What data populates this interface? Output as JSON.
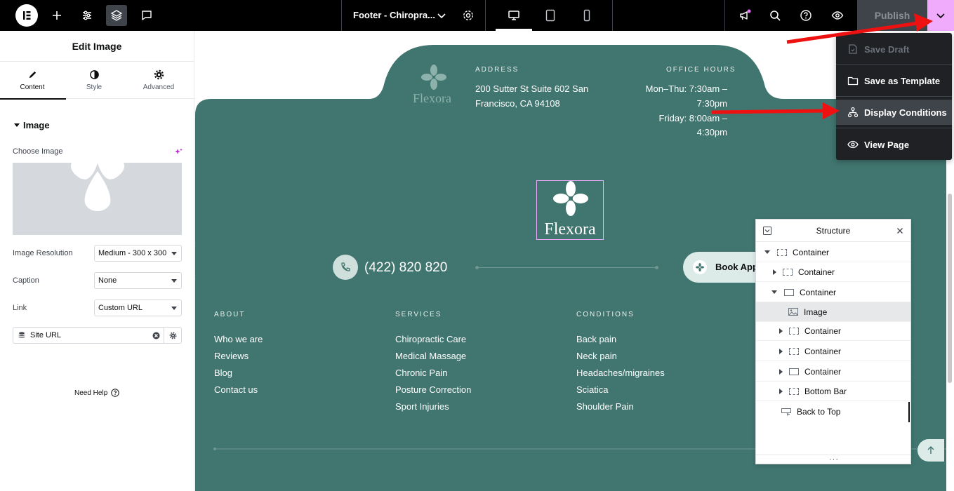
{
  "topbar": {
    "document_title": "Footer - Chiropra...",
    "publish_label": "Publish",
    "icons": [
      "elementor-logo-icon",
      "plus-icon",
      "settings-sliders-icon",
      "layers-icon",
      "comments-icon",
      "chevron-down-icon",
      "gear-icon",
      "desktop-icon",
      "tablet-icon",
      "mobile-icon",
      "megaphone-icon",
      "search-icon",
      "help-icon",
      "eye-icon",
      "chevron-down-icon"
    ]
  },
  "publish_menu": {
    "items": [
      {
        "label": "Save Draft",
        "icon": "save-draft-icon",
        "disabled": true
      },
      {
        "label": "Save as Template",
        "icon": "folder-icon",
        "disabled": false
      },
      {
        "label": "Display Conditions",
        "icon": "sitemap-icon",
        "disabled": false
      },
      {
        "label": "View Page",
        "icon": "eye-icon",
        "disabled": false
      }
    ]
  },
  "panel": {
    "title": "Edit Image",
    "tabs": [
      {
        "label": "Content",
        "icon": "pencil-icon",
        "active": true
      },
      {
        "label": "Style",
        "icon": "half-circle-icon",
        "active": false
      },
      {
        "label": "Advanced",
        "icon": "gear-icon",
        "active": false
      }
    ],
    "section_title": "Image",
    "choose_image_label": "Choose Image",
    "image_resolution_label": "Image Resolution",
    "image_resolution_value": "Medium - 300 x 300",
    "caption_label": "Caption",
    "caption_value": "None",
    "link_label": "Link",
    "link_value": "Custom URL",
    "url_value": "Site URL",
    "need_help": "Need Help"
  },
  "canvas": {
    "brand_name": "Flexora",
    "address_title": "ADDRESS",
    "address_line1": "200 Sutter St Suite 602 San",
    "address_line2": "Francisco, CA 94108",
    "hours_title": "OFFICE HOURS",
    "hours_line1": "Mon–Thu: 7:30am –",
    "hours_line2": "7:30pm",
    "hours_line3": "Friday: 8:00am –",
    "hours_line4": "4:30pm",
    "phone": "(422) 820 820",
    "book_button": "Book App",
    "columns": [
      {
        "title": "ABOUT",
        "links": [
          "Who we are",
          "Reviews",
          "Blog",
          "Contact us"
        ]
      },
      {
        "title": "SERVICES",
        "links": [
          "Chiropractic Care",
          "Medical Massage",
          "Chronic Pain",
          "Posture Correction",
          "Sport Injuries"
        ]
      },
      {
        "title": "CONDITIONS",
        "links": [
          "Back pain",
          "Neck pain",
          "Headaches/migraines",
          "Sciatica",
          "Shoulder Pain"
        ]
      }
    ],
    "colors": {
      "footer_green": "#41756f",
      "accent_pink": "#f0abfc"
    }
  },
  "structure": {
    "title": "Structure",
    "rows": [
      {
        "label": "Container",
        "depth": 0,
        "toggle": "open"
      },
      {
        "label": "Container",
        "depth": 1,
        "toggle": "closed"
      },
      {
        "label": "Container",
        "depth": 1,
        "toggle": "open"
      },
      {
        "label": "Image",
        "depth": 2,
        "toggle": "none",
        "selected": true
      },
      {
        "label": "Container",
        "depth": 2,
        "toggle": "closed"
      },
      {
        "label": "Container",
        "depth": 2,
        "toggle": "closed"
      },
      {
        "label": "Container",
        "depth": 2,
        "toggle": "closed"
      },
      {
        "label": "Bottom Bar",
        "depth": 2,
        "toggle": "closed"
      },
      {
        "label": "Back to Top",
        "depth": 1,
        "toggle": "none"
      }
    ]
  }
}
